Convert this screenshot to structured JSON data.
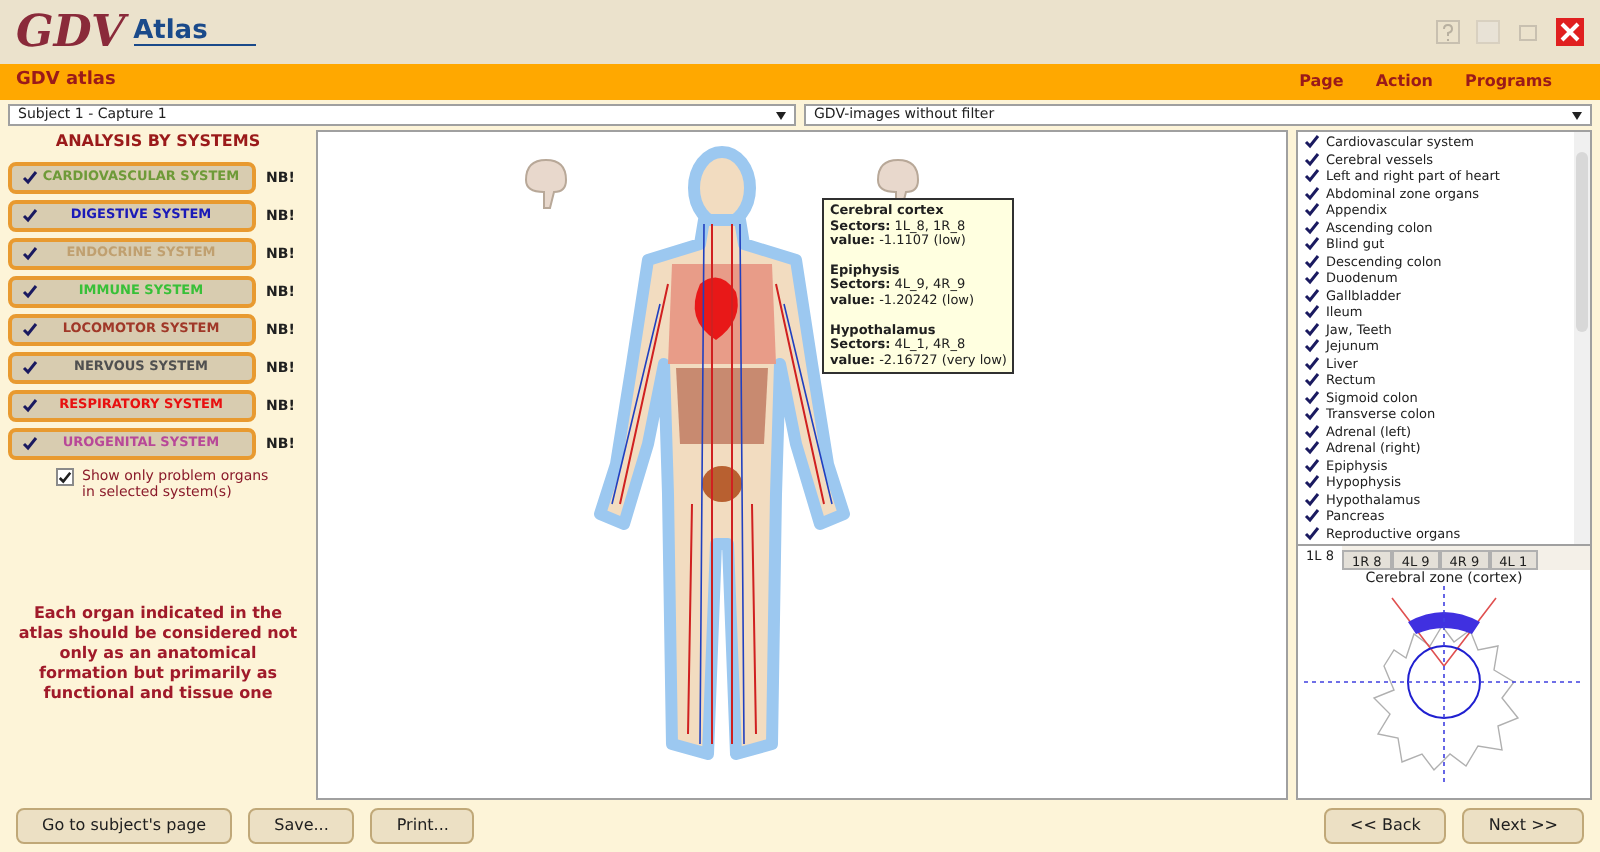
{
  "logo": {
    "main": "GDV",
    "sub": "Atlas"
  },
  "header": {
    "title": "GDV atlas",
    "menu": [
      "Page",
      "Action",
      "Programs"
    ]
  },
  "selectors": {
    "subject": "Subject 1 - Capture 1",
    "filter": "GDV-images without filter"
  },
  "systems_panel": {
    "heading": "ANALYSIS BY SYSTEMS",
    "systems": [
      {
        "label": "CARDIOVASCULAR SYSTEM",
        "checked": true,
        "color": "#6e9a38",
        "badge": "NB!"
      },
      {
        "label": "DIGESTIVE SYSTEM",
        "checked": true,
        "color": "#1a1ab8",
        "badge": "NB!"
      },
      {
        "label": "ENDOCRINE SYSTEM",
        "checked": true,
        "color": "#c0a070",
        "badge": "NB!"
      },
      {
        "label": "IMMUNE SYSTEM",
        "checked": true,
        "color": "#38c038",
        "badge": "NB!"
      },
      {
        "label": "LOCOMOTOR SYSTEM",
        "checked": true,
        "color": "#a03828",
        "badge": "NB!"
      },
      {
        "label": "NERVOUS SYSTEM",
        "checked": true,
        "color": "#505050",
        "badge": "NB!"
      },
      {
        "label": "RESPIRATORY SYSTEM",
        "checked": true,
        "color": "#e81010",
        "badge": "NB!"
      },
      {
        "label": "UROGENITAL SYSTEM",
        "checked": true,
        "color": "#b84898",
        "badge": "NB!"
      }
    ],
    "problem_only": {
      "label": "Show only problem organs in selected system(s)",
      "checked": true
    },
    "note": "Each organ indicated in the atlas should be considered not only as an anatomical formation but primarily as functional and tissue one"
  },
  "tooltip": [
    {
      "title": "Cerebral cortex",
      "sectors": "**Sectors:** 1L_8, 1R_8",
      "value": "**value:** -1.1107 (low)"
    },
    {
      "title": "Epiphysis",
      "sectors": "**Sectors:** 4L_9, 4R_9",
      "value": "**value:** -1.20242 (low)"
    },
    {
      "title": "Hypothalamus",
      "sectors": "**Sectors:** 4L_1, 4R_8",
      "value": "**value:** -2.16727 (very low)"
    }
  ],
  "organs": [
    {
      "label": "Cardiovascular system",
      "checked": true
    },
    {
      "label": "Cerebral vessels",
      "checked": true
    },
    {
      "label": "Left and right part of heart",
      "checked": true
    },
    {
      "label": "Abdominal zone organs",
      "checked": true
    },
    {
      "label": "Appendix",
      "checked": true
    },
    {
      "label": "Ascending colon",
      "checked": true
    },
    {
      "label": "Blind gut",
      "checked": true
    },
    {
      "label": "Descending colon",
      "checked": true
    },
    {
      "label": "Duodenum",
      "checked": true
    },
    {
      "label": "Gallbladder",
      "checked": true
    },
    {
      "label": "Ileum",
      "checked": true
    },
    {
      "label": "Jaw, Teeth",
      "checked": true
    },
    {
      "label": "Jejunum",
      "checked": true
    },
    {
      "label": "Liver",
      "checked": true
    },
    {
      "label": "Rectum",
      "checked": true
    },
    {
      "label": "Sigmoid colon",
      "checked": true
    },
    {
      "label": "Transverse colon",
      "checked": true
    },
    {
      "label": "Adrenal (left)",
      "checked": true
    },
    {
      "label": "Adrenal (right)",
      "checked": true
    },
    {
      "label": "Epiphysis",
      "checked": true
    },
    {
      "label": "Hypophysis",
      "checked": true
    },
    {
      "label": "Hypothalamus",
      "checked": true
    },
    {
      "label": "Pancreas",
      "checked": true
    },
    {
      "label": "Reproductive organs",
      "checked": true
    }
  ],
  "sector_tabs": [
    {
      "label": "1L 8",
      "selected": true
    },
    {
      "label": "1R 8",
      "selected": false
    },
    {
      "label": "4L 9",
      "selected": false
    },
    {
      "label": "4R 9",
      "selected": false
    },
    {
      "label": "4L 1",
      "selected": false
    }
  ],
  "gdv_caption": "Cerebral zone (cortex)",
  "footer": {
    "left": [
      "Go to subject's page",
      "Save...",
      "Print..."
    ],
    "right": [
      "<< Back",
      "Next >>"
    ]
  }
}
